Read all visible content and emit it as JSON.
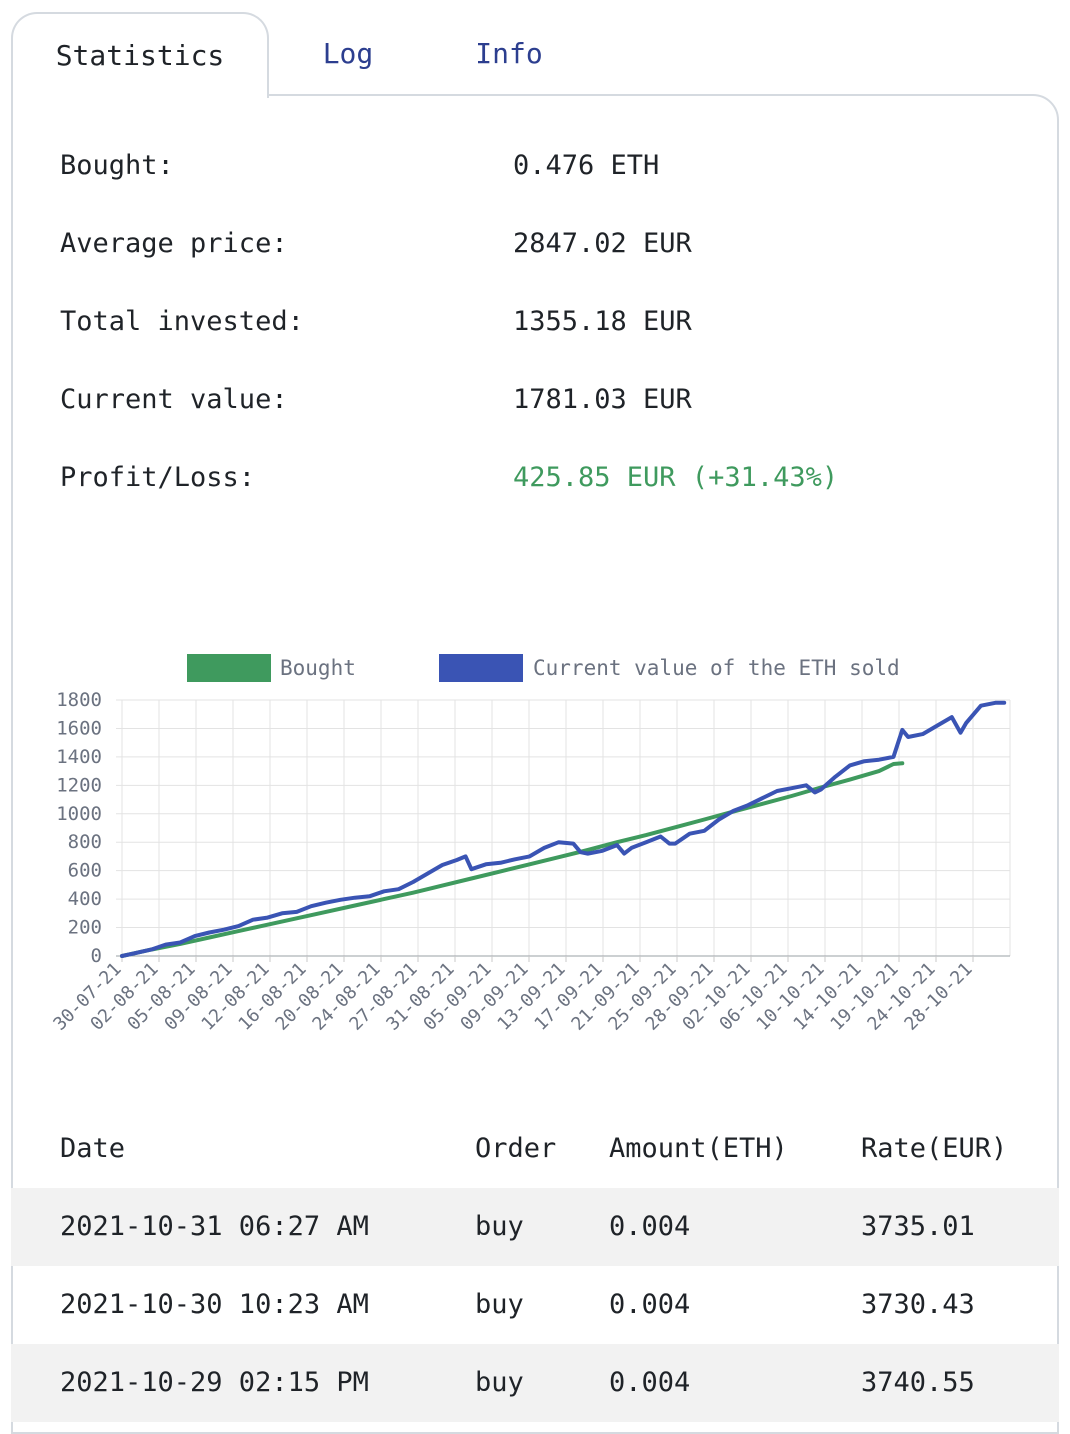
{
  "tabs": [
    {
      "label": "Statistics",
      "active": true
    },
    {
      "label": "Log",
      "active": false
    },
    {
      "label": "Info",
      "active": false
    }
  ],
  "stats": [
    {
      "label": "Bought:",
      "value": "0.476 ETH"
    },
    {
      "label": "Average price:",
      "value": "2847.02 EUR"
    },
    {
      "label": "Total invested:",
      "value": "1355.18 EUR"
    },
    {
      "label": "Current value:",
      "value": "1781.03 EUR"
    },
    {
      "label": "Profit/Loss:",
      "value": "425.85 EUR (+31.43%)",
      "color": "#3f9a5e"
    }
  ],
  "chart_data": {
    "type": "line",
    "legend": [
      {
        "name": "Bought",
        "color": "#3f9a5e"
      },
      {
        "name": "Current value of the ETH sold",
        "color": "#3a54b4"
      }
    ],
    "ylim": [
      0,
      1800
    ],
    "yticks": [
      0,
      200,
      400,
      600,
      800,
      1000,
      1200,
      1400,
      1600,
      1800
    ],
    "grid": true,
    "tick_labels": [
      "30-07-21",
      "02-08-21",
      "05-08-21",
      "09-08-21",
      "12-08-21",
      "16-08-21",
      "20-08-21",
      "24-08-21",
      "27-08-21",
      "31-08-21",
      "05-09-21",
      "09-09-21",
      "13-09-21",
      "17-09-21",
      "21-09-21",
      "25-09-21",
      "28-09-21",
      "02-10-21",
      "06-10-21",
      "10-10-21",
      "14-10-21",
      "19-10-21",
      "24-10-21",
      "28-10-21"
    ],
    "series": [
      {
        "name": "Bought",
        "color": "#3f9a5e",
        "points": [
          [
            0,
            0
          ],
          [
            2,
            45
          ],
          [
            4,
            85
          ],
          [
            6,
            130
          ],
          [
            8,
            175
          ],
          [
            10,
            220
          ],
          [
            12,
            265
          ],
          [
            14,
            310
          ],
          [
            16,
            355
          ],
          [
            18,
            400
          ],
          [
            20,
            445
          ],
          [
            22,
            495
          ],
          [
            24,
            545
          ],
          [
            26,
            595
          ],
          [
            28,
            645
          ],
          [
            30,
            695
          ],
          [
            32,
            745
          ],
          [
            34,
            800
          ],
          [
            36,
            850
          ],
          [
            38,
            905
          ],
          [
            40,
            960
          ],
          [
            42,
            1015
          ],
          [
            44,
            1070
          ],
          [
            46,
            1125
          ],
          [
            48,
            1185
          ],
          [
            50,
            1240
          ],
          [
            52,
            1300
          ],
          [
            53,
            1350
          ],
          [
            53.6,
            1355
          ]
        ]
      },
      {
        "name": "Current value of the ETH sold",
        "color": "#3a54b4",
        "points": [
          [
            0,
            0
          ],
          [
            2,
            45
          ],
          [
            3,
            80
          ],
          [
            4,
            95
          ],
          [
            5,
            140
          ],
          [
            6,
            165
          ],
          [
            7,
            185
          ],
          [
            8,
            210
          ],
          [
            9,
            255
          ],
          [
            10,
            270
          ],
          [
            11,
            300
          ],
          [
            12,
            310
          ],
          [
            13,
            350
          ],
          [
            14,
            375
          ],
          [
            15,
            395
          ],
          [
            16,
            410
          ],
          [
            17,
            420
          ],
          [
            18,
            455
          ],
          [
            19,
            470
          ],
          [
            20,
            520
          ],
          [
            21,
            580
          ],
          [
            22,
            640
          ],
          [
            23,
            675
          ],
          [
            23.6,
            700
          ],
          [
            24,
            610
          ],
          [
            25,
            645
          ],
          [
            26,
            655
          ],
          [
            27,
            680
          ],
          [
            28,
            700
          ],
          [
            29,
            760
          ],
          [
            30,
            800
          ],
          [
            31,
            790
          ],
          [
            31.5,
            730
          ],
          [
            32,
            720
          ],
          [
            33,
            740
          ],
          [
            34,
            780
          ],
          [
            34.5,
            720
          ],
          [
            35,
            760
          ],
          [
            36,
            800
          ],
          [
            37,
            840
          ],
          [
            37.6,
            790
          ],
          [
            38,
            790
          ],
          [
            39,
            860
          ],
          [
            40,
            880
          ],
          [
            41,
            960
          ],
          [
            42,
            1020
          ],
          [
            43,
            1060
          ],
          [
            44,
            1110
          ],
          [
            45,
            1160
          ],
          [
            46,
            1180
          ],
          [
            47,
            1200
          ],
          [
            47.6,
            1150
          ],
          [
            48,
            1170
          ],
          [
            49,
            1260
          ],
          [
            50,
            1340
          ],
          [
            51,
            1370
          ],
          [
            52,
            1380
          ],
          [
            53,
            1400
          ],
          [
            53.6,
            1590
          ],
          [
            54,
            1540
          ],
          [
            55,
            1560
          ],
          [
            56,
            1620
          ],
          [
            57,
            1680
          ],
          [
            57.6,
            1570
          ],
          [
            58,
            1640
          ],
          [
            59,
            1760
          ],
          [
            60,
            1780
          ],
          [
            60.6,
            1781
          ]
        ]
      }
    ]
  },
  "table": {
    "headers": [
      "Date",
      "Order",
      "Amount(ETH)",
      "Rate(EUR)"
    ],
    "rows": [
      [
        "2021-10-31 06:27 AM",
        "buy",
        "0.004",
        "3735.01"
      ],
      [
        "2021-10-30 10:23 AM",
        "buy",
        "0.004",
        "3730.43"
      ],
      [
        "2021-10-29 02:15 PM",
        "buy",
        "0.004",
        "3740.55"
      ]
    ]
  }
}
